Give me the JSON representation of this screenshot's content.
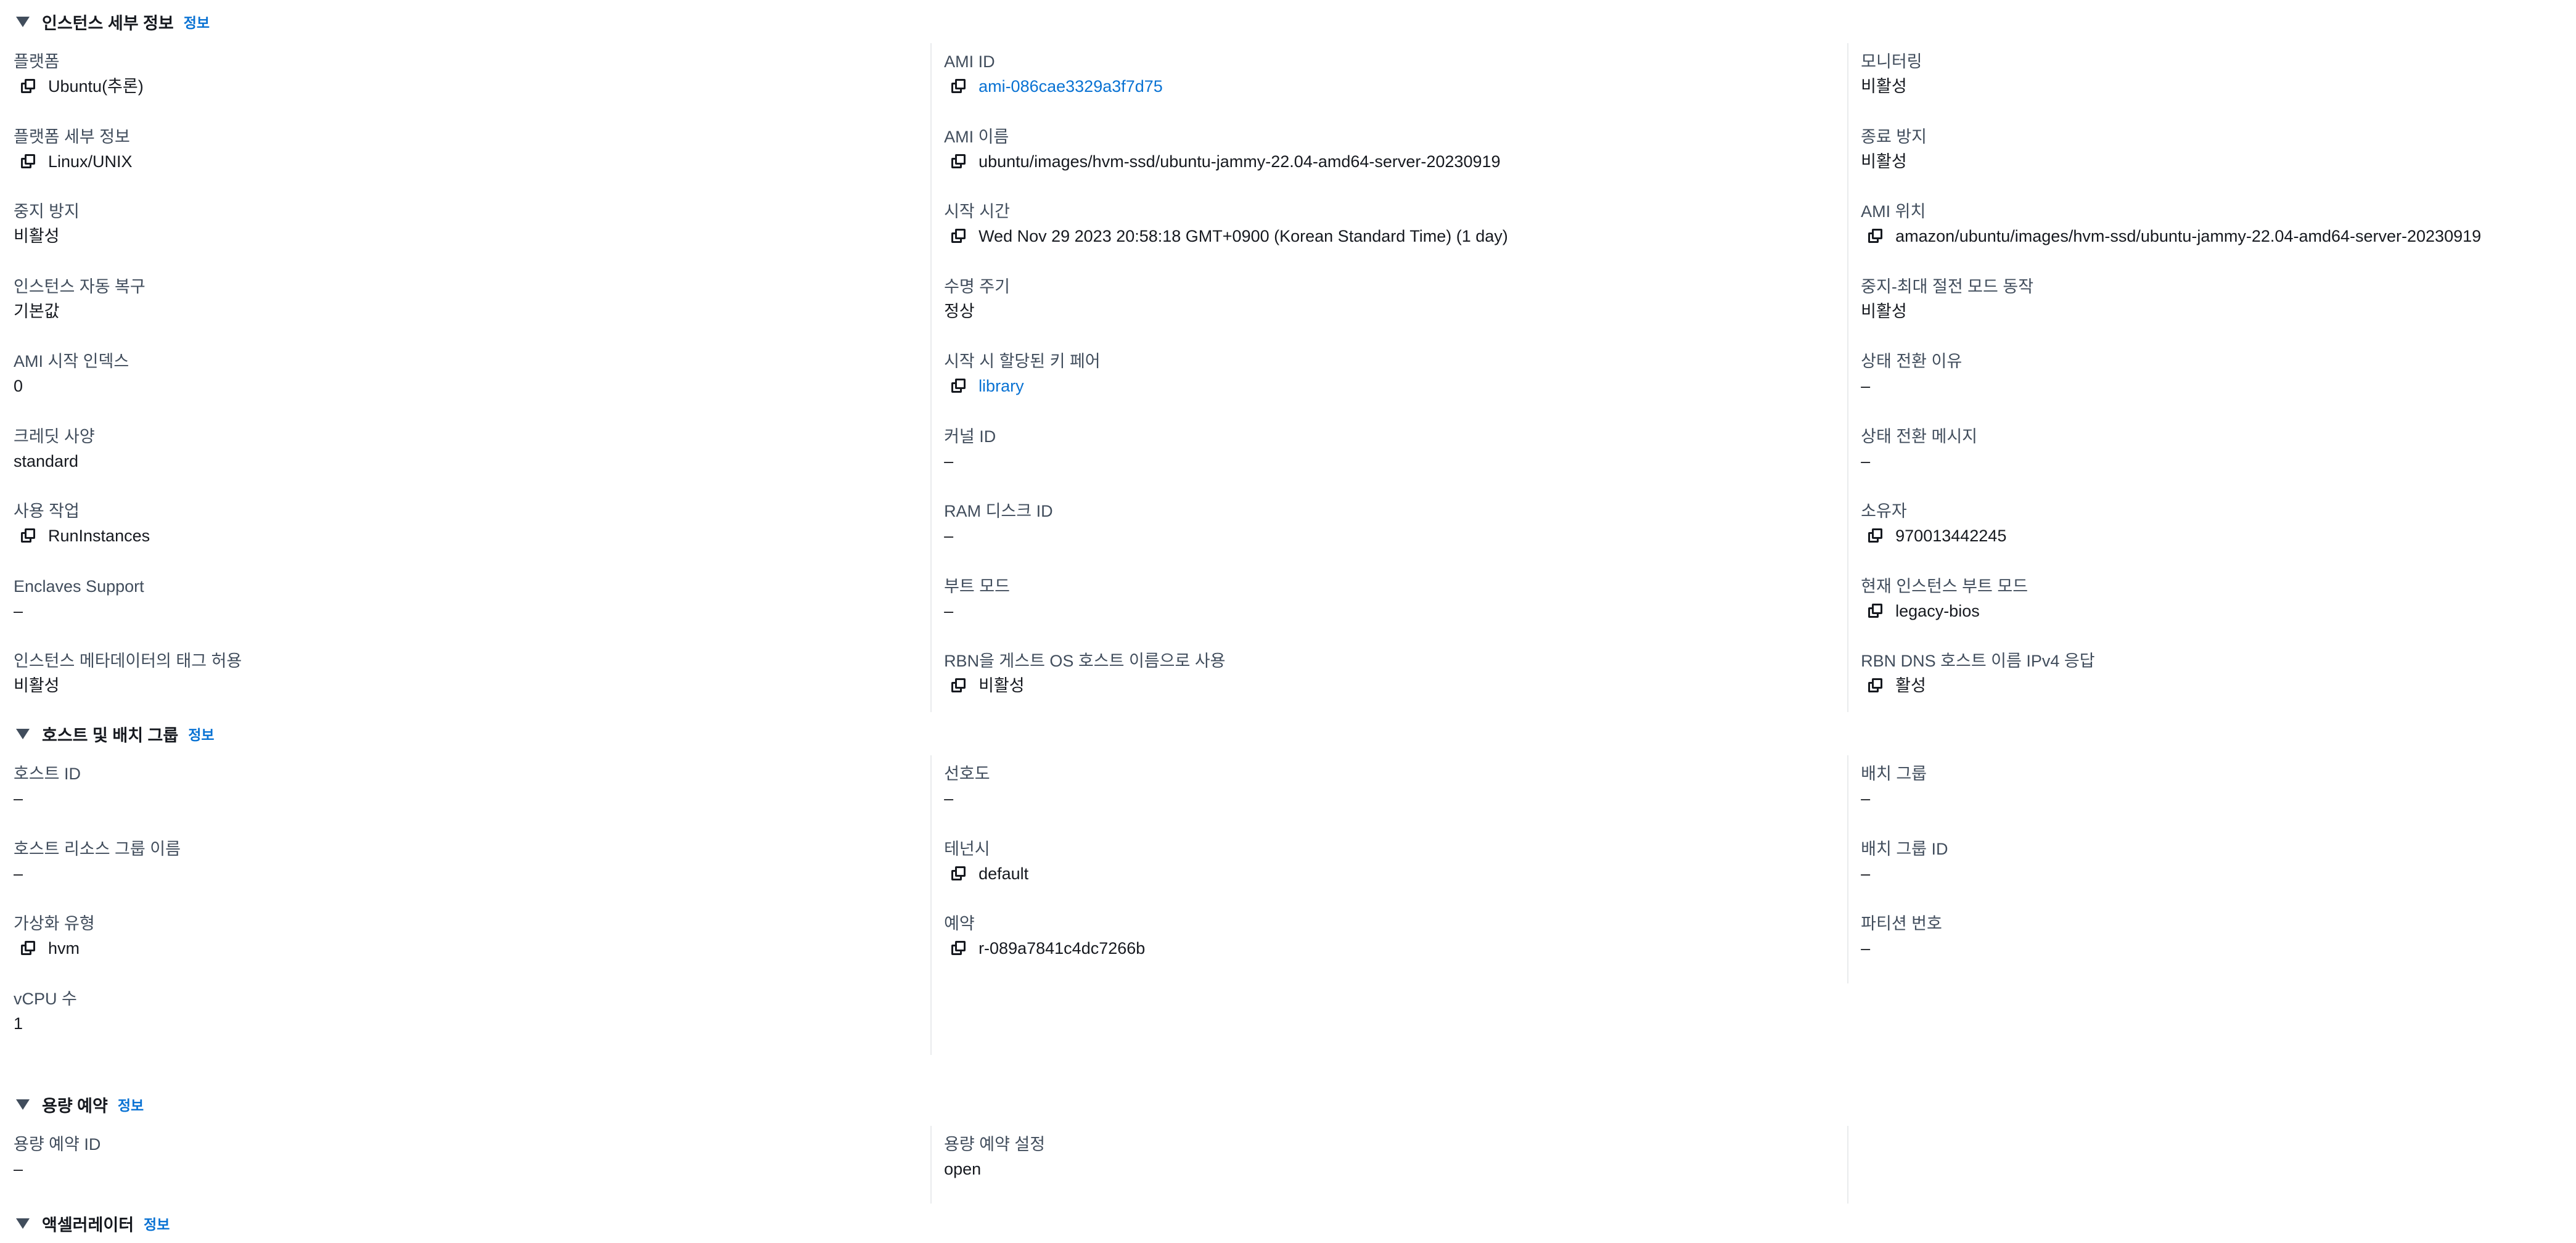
{
  "sections": {
    "instance_details": {
      "title": "인스턴스 세부 정보",
      "info": "정보",
      "col1": [
        {
          "label": "플랫폼",
          "value": "Ubuntu(추론)"
        },
        {
          "label": "플랫폼 세부 정보",
          "value": "Linux/UNIX"
        },
        {
          "label": "중지 방지",
          "value": "비활성"
        },
        {
          "label": "인스턴스 자동 복구",
          "value": "기본값"
        },
        {
          "label": "AMI 시작 인덱스",
          "value": "0"
        },
        {
          "label": "크레딧 사양",
          "value": "standard"
        },
        {
          "label": "사용 작업",
          "value": "RunInstances"
        },
        {
          "label": "Enclaves Support",
          "value": "–"
        },
        {
          "label": "인스턴스 메타데이터의 태그 허용",
          "value": "비활성"
        }
      ],
      "col2": [
        {
          "label": "AMI ID",
          "value": "ami-086cae3329a3f7d75"
        },
        {
          "label": "AMI 이름",
          "value": "ubuntu/images/hvm-ssd/ubuntu-jammy-22.04-amd64-server-20230919"
        },
        {
          "label": "시작 시간",
          "value": "Wed Nov 29 2023 20:58:18 GMT+0900 (Korean Standard Time) (1 day)"
        },
        {
          "label": "수명 주기",
          "value": "정상"
        },
        {
          "label": "시작 시 할당된 키 페어",
          "value": "library"
        },
        {
          "label": "커널 ID",
          "value": "–"
        },
        {
          "label": "RAM 디스크 ID",
          "value": "–"
        },
        {
          "label": "부트 모드",
          "value": "–"
        },
        {
          "label": "RBN을 게스트 OS 호스트 이름으로 사용",
          "value": "비활성"
        }
      ],
      "col3": [
        {
          "label": "모니터링",
          "value": "비활성"
        },
        {
          "label": "종료 방지",
          "value": "비활성"
        },
        {
          "label": "AMI 위치",
          "value": "amazon/ubuntu/images/hvm-ssd/ubuntu-jammy-22.04-amd64-server-20230919"
        },
        {
          "label": "중지-최대 절전 모드 동작",
          "value": "비활성"
        },
        {
          "label": "상태 전환 이유",
          "value": "–"
        },
        {
          "label": "상태 전환 메시지",
          "value": "–"
        },
        {
          "label": "소유자",
          "value": "970013442245"
        },
        {
          "label": "현재 인스턴스 부트 모드",
          "value": "legacy-bios"
        },
        {
          "label": "RBN DNS 호스트 이름 IPv4 응답",
          "value": "활성"
        }
      ]
    },
    "host_placement": {
      "title": "호스트 및 배치 그룹",
      "info": "정보",
      "col1": [
        {
          "label": "호스트 ID",
          "value": "–"
        },
        {
          "label": "호스트 리소스 그룹 이름",
          "value": "–"
        },
        {
          "label": "가상화 유형",
          "value": "hvm"
        },
        {
          "label": "vCPU 수",
          "value": "1"
        }
      ],
      "col2": [
        {
          "label": "선호도",
          "value": "–"
        },
        {
          "label": "테넌시",
          "value": "default"
        },
        {
          "label": "예약",
          "value": "r-089a7841c4dc7266b"
        }
      ],
      "col3": [
        {
          "label": "배치 그룹",
          "value": "–"
        },
        {
          "label": "배치 그룹 ID",
          "value": "–"
        },
        {
          "label": "파티션 번호",
          "value": "–"
        }
      ]
    },
    "capacity_reservation": {
      "title": "용량 예약",
      "info": "정보",
      "col1": [
        {
          "label": "용량 예약 ID",
          "value": "–"
        }
      ],
      "col2": [
        {
          "label": "용량 예약 설정",
          "value": "open"
        }
      ]
    },
    "accelerator": {
      "title": "액셀러레이터",
      "info": "정보"
    }
  }
}
